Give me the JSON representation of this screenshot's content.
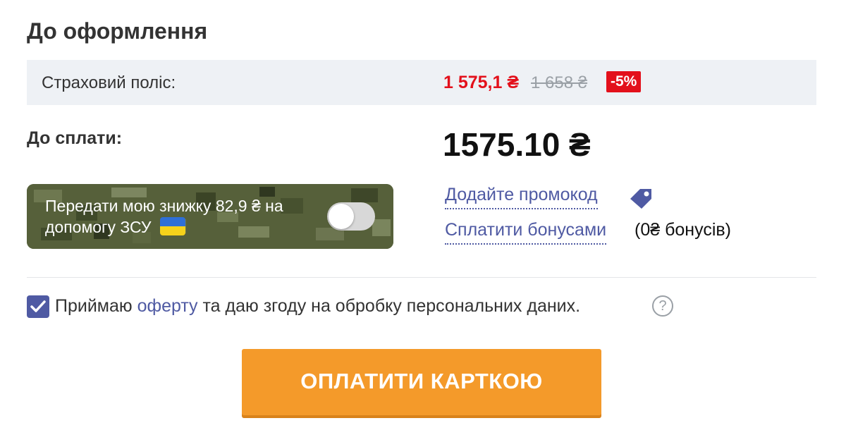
{
  "checkout": {
    "title": "До оформлення",
    "policy": {
      "label": "Страховий поліс:",
      "price_new": "1 575,1 ₴",
      "price_old": "1 658 ₴",
      "discount_badge": "-5%"
    },
    "payment": {
      "label": "До сплати:",
      "total": "1575.10 ₴"
    },
    "donation": {
      "text": "Передати мою знижку 82,9 ₴ на допомогу ЗСУ",
      "toggle_on": false
    },
    "promo": {
      "link_text": "Додайте промокод",
      "icon": "tag-icon"
    },
    "bonuses": {
      "link_text": "Сплатити бонусами",
      "count_text": "(0₴ бонусів)"
    },
    "consent": {
      "checked": true,
      "text_before": "Приймаю ",
      "offer_link": "оферту",
      "text_after": " та даю згоду на обробку персональних даних.",
      "help_icon": "?"
    },
    "submit_label": "ОПЛАТИТИ КАРТКОЮ"
  },
  "colors": {
    "accent_link": "#4f5aa3",
    "price_red": "#e3101b",
    "button_orange": "#f49a2a",
    "policy_row_bg": "#eef1f5"
  }
}
